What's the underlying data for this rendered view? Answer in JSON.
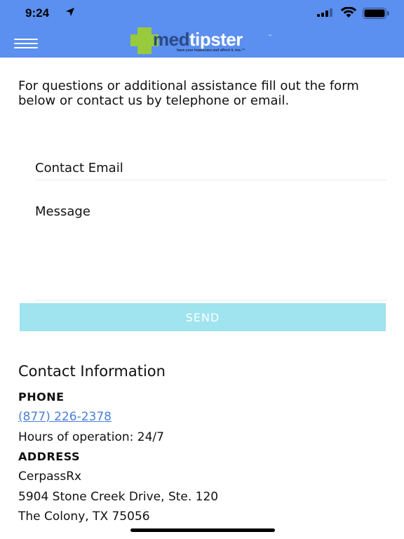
{
  "status_bar": {
    "time": "9:24",
    "icons": [
      "location-arrow-icon",
      "cellular-signal-icon",
      "wifi-icon",
      "battery-icon"
    ]
  },
  "header": {
    "background_color": "#5b8ff0",
    "menu_icon": "hamburger-menu-icon",
    "logo": {
      "part1": "med",
      "part2": "tipster",
      "trademark": "™",
      "tagline": "have your healthcare and afford it, too.™",
      "cross_color": "#99c93d"
    }
  },
  "intro": {
    "text": "For questions or additional assistance fill out the form below or contact us by telephone or email."
  },
  "form": {
    "email": {
      "placeholder": "Contact Email",
      "value": ""
    },
    "message": {
      "placeholder": "Message",
      "value": ""
    },
    "send_label": "SEND",
    "send_color": "#9fe4ee"
  },
  "contact": {
    "title": "Contact Information",
    "phone_label": "PHONE",
    "phone_number": "(877) 226-2378",
    "hours": "Hours of operation: 24/7",
    "address_label": "ADDRESS",
    "address_lines": [
      "CerpassRx",
      "5904 Stone Creek Drive, Ste. 120",
      "The Colony, TX 75056"
    ],
    "link_color": "#4a7fd9"
  }
}
